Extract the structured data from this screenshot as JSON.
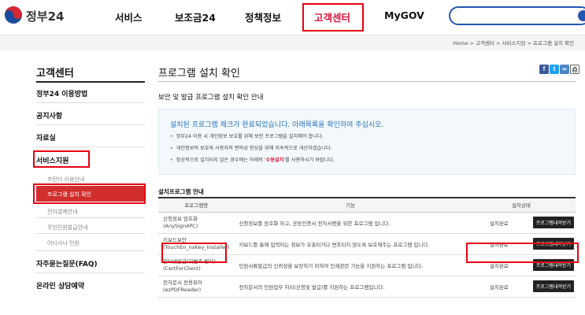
{
  "header": {
    "logo_text": "정부24",
    "nav": [
      "서비스",
      "보조금24",
      "정책정보",
      "고객센터",
      "MyGOV"
    ]
  },
  "breadcrumb": "Home > 고객센터 > 서비스지원 > 프로그램 설치 확인",
  "sidebar": {
    "title": "고객센터",
    "items": [
      "정부24 이용방법",
      "공지사항",
      "자료실",
      "서비스지원"
    ],
    "subitems": [
      "프린터 이용안내",
      "프로그램 설치 확인",
      "전자결제안내",
      "무인민원발급안내",
      "어디서나 민원"
    ],
    "bottom_items": [
      "자주묻는질문(FAQ)",
      "온라인 상담예약"
    ]
  },
  "main": {
    "title": "프로그램 설치 확인",
    "subtitle": "보안 및 발급 프로그램 설치 확인 안내",
    "notice": {
      "head": "설치된 프로그램 체크가 완료되었습니다. 아래목록을 확인하여 주십시오.",
      "bullets": [
        "정부24 이용 시 개인정보 보호를 위해 보안 프로그램을 설치해야 합니다.",
        "개인정보의 보호와 사용자의 편의성 향상을 위해 지속적으로 개선하겠습니다."
      ],
      "bullet3_pre": "정상적으로 설치되지 않은 경우에는 아래의 '",
      "bullet3_link": "수동설치",
      "bullet3_post": "'를 사용하시기 바랍니다."
    },
    "table_title": "설치프로그램 안내",
    "table": {
      "headers": [
        "프로그램명",
        "기능",
        "설치상태"
      ],
      "rows": [
        {
          "name": "신청정보 암호화",
          "sub": "(AnySign4PC)",
          "desc": "신청정보를 암호화 하고, 공동인증서 전자서명을 위한 프로그램 입니다.",
          "status": "설치완료",
          "button": "프로그램내려받기"
        },
        {
          "name": "키보드보안",
          "sub": "(TouchEn_nxKey_Installer)",
          "desc": "키보드를 통해 입력되는 정보가 유출되거나 변조되지 않도록 보호해주는 프로그램 입니다.",
          "status": "설치완료",
          "button": "프로그램내려받기"
        },
        {
          "name": "인터넷발급(위변조 방지)",
          "sub": "(CertForClient)",
          "desc": "민원서류발급의 신뢰성을 보장하기 위하여 인쇄관련 기능을 지원하는 프로그램 입니다.",
          "status": "설치완료",
          "button": "프로그램내려받기"
        },
        {
          "name": "전자문서 전용뷰어",
          "sub": "(ezPDFReader)",
          "desc": "전자문서의 민원업무 처리(신청및 발급)를 지원하는 프로그램입니다.",
          "status": "설치완료",
          "button": "프로그램내려받기"
        }
      ]
    }
  },
  "colors": {
    "accent_red": "#e60012",
    "sidebar_active": "#d22e2e",
    "brand_blue": "#2556b4",
    "notice_blue": "#2b72b8"
  },
  "icons": [
    "facebook-icon",
    "twitter-icon",
    "link-icon",
    "print-icon",
    "search-icon"
  ]
}
